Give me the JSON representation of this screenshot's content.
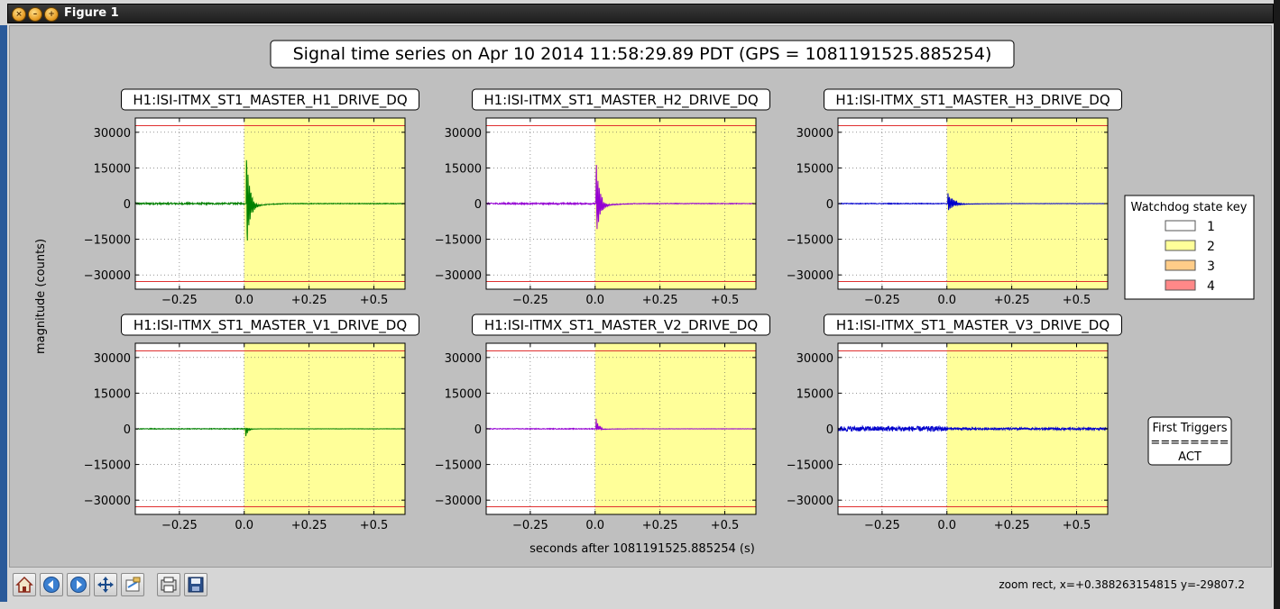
{
  "window": {
    "title": "Figure 1"
  },
  "figure": {
    "suptitle": "Signal time series on Apr 10 2014 11:58:29.89 PDT (GPS = 1081191525.885254)",
    "ylabel": "magnitude (counts)",
    "xlabel": "seconds after 1081191525.885254 (s)"
  },
  "legend": {
    "title": "Watchdog state key",
    "entries": [
      {
        "label": "1",
        "color": "#ffffff"
      },
      {
        "label": "2",
        "color": "#ffff99"
      },
      {
        "label": "3",
        "color": "#ffcc88"
      },
      {
        "label": "4",
        "color": "#ff8888"
      }
    ]
  },
  "triggers": {
    "line1": "First Triggers",
    "line2": "========",
    "line3": "ACT"
  },
  "toolbar": {
    "buttons": [
      "home-icon",
      "back-icon",
      "forward-icon",
      "pan-icon",
      "zoom-icon",
      "subplots-icon",
      "save-icon"
    ],
    "status": "zoom rect, x=+0.388263154815 y=-29807.2"
  },
  "chart_data": [
    {
      "type": "line",
      "title": "H1:ISI-ITMX_ST1_MASTER_H1_DRIVE_DQ",
      "color": "#008000",
      "xlim": [
        -0.42,
        0.62
      ],
      "ylim": [
        -36000,
        36000
      ],
      "xticks": [
        "−0.25",
        "0.0",
        "+0.25",
        "+0.5"
      ],
      "xtick_values": [
        -0.25,
        0,
        0.25,
        0.5
      ],
      "yticks": [
        "30000",
        "15000",
        "0",
        "−15000",
        "−30000"
      ],
      "ytick_values": [
        30000,
        15000,
        0,
        -15000,
        -30000
      ],
      "threshold": 32768,
      "state_regions": [
        {
          "x": [
            -0.42,
            0
          ],
          "state": "1"
        },
        {
          "x": [
            0,
            0.62
          ],
          "state": "2"
        }
      ],
      "transient": {
        "t0": 0.008,
        "peak_pos": 21000,
        "peak_neg": -22000,
        "decay": 0.012,
        "baseline_noise": 350
      }
    },
    {
      "type": "line",
      "title": "H1:ISI-ITMX_ST1_MASTER_H2_DRIVE_DQ",
      "color": "#9400d3",
      "xlim": [
        -0.42,
        0.62
      ],
      "ylim": [
        -36000,
        36000
      ],
      "xticks": [
        "−0.25",
        "0.0",
        "+0.25",
        "+0.5"
      ],
      "xtick_values": [
        -0.25,
        0,
        0.25,
        0.5
      ],
      "yticks": [
        "30000",
        "15000",
        "0",
        "−15000",
        "−30000"
      ],
      "ytick_values": [
        30000,
        15000,
        0,
        -15000,
        -30000
      ],
      "threshold": 32768,
      "state_regions": [
        {
          "x": [
            -0.42,
            0
          ],
          "state": "1"
        },
        {
          "x": [
            0,
            0.62
          ],
          "state": "2"
        }
      ],
      "transient": {
        "t0": 0.004,
        "peak_pos": 18000,
        "peak_neg": -17500,
        "decay": 0.012,
        "baseline_noise": 300
      }
    },
    {
      "type": "line",
      "title": "H1:ISI-ITMX_ST1_MASTER_H3_DRIVE_DQ",
      "color": "#0000cd",
      "xlim": [
        -0.42,
        0.62
      ],
      "ylim": [
        -36000,
        36000
      ],
      "xticks": [
        "−0.25",
        "0.0",
        "+0.25",
        "+0.5"
      ],
      "xtick_values": [
        -0.25,
        0,
        0.25,
        0.5
      ],
      "yticks": [
        "30000",
        "15000",
        "0",
        "−15000",
        "−30000"
      ],
      "ytick_values": [
        30000,
        15000,
        0,
        -15000,
        -30000
      ],
      "threshold": 32768,
      "state_regions": [
        {
          "x": [
            -0.42,
            0
          ],
          "state": "1"
        },
        {
          "x": [
            0,
            0.62
          ],
          "state": "2"
        }
      ],
      "transient": {
        "t0": 0.003,
        "peak_pos": 5000,
        "peak_neg": -3800,
        "decay": 0.02,
        "baseline_noise": 150
      }
    },
    {
      "type": "line",
      "title": "H1:ISI-ITMX_ST1_MASTER_V1_DRIVE_DQ",
      "color": "#008000",
      "xlim": [
        -0.42,
        0.62
      ],
      "ylim": [
        -36000,
        36000
      ],
      "xticks": [
        "−0.25",
        "0.0",
        "+0.25",
        "+0.5"
      ],
      "xtick_values": [
        -0.25,
        0,
        0.25,
        0.5
      ],
      "yticks": [
        "30000",
        "15000",
        "0",
        "−15000",
        "−30000"
      ],
      "ytick_values": [
        30000,
        15000,
        0,
        -15000,
        -30000
      ],
      "threshold": 32768,
      "state_regions": [
        {
          "x": [
            -0.42,
            0
          ],
          "state": "1"
        },
        {
          "x": [
            0,
            0.62
          ],
          "state": "2"
        }
      ],
      "transient": {
        "t0": 0.003,
        "peak_pos": 500,
        "peak_neg": -4500,
        "decay": 0.01,
        "baseline_noise": 150
      }
    },
    {
      "type": "line",
      "title": "H1:ISI-ITMX_ST1_MASTER_V2_DRIVE_DQ",
      "color": "#9400d3",
      "xlim": [
        -0.42,
        0.62
      ],
      "ylim": [
        -36000,
        36000
      ],
      "xticks": [
        "−0.25",
        "0.0",
        "+0.25",
        "+0.5"
      ],
      "xtick_values": [
        -0.25,
        0,
        0.25,
        0.5
      ],
      "yticks": [
        "30000",
        "15000",
        "0",
        "−15000",
        "−30000"
      ],
      "ytick_values": [
        30000,
        15000,
        0,
        -15000,
        -30000
      ],
      "threshold": 32768,
      "state_regions": [
        {
          "x": [
            -0.42,
            0
          ],
          "state": "1"
        },
        {
          "x": [
            0,
            0.62
          ],
          "state": "2"
        }
      ],
      "transient": {
        "t0": 0.003,
        "peak_pos": 4800,
        "peak_neg": -500,
        "decay": 0.01,
        "baseline_noise": 150
      }
    },
    {
      "type": "line",
      "title": "H1:ISI-ITMX_ST1_MASTER_V3_DRIVE_DQ",
      "color": "#0000cd",
      "xlim": [
        -0.42,
        0.62
      ],
      "ylim": [
        -36000,
        36000
      ],
      "xticks": [
        "−0.25",
        "0.0",
        "+0.25",
        "+0.5"
      ],
      "xtick_values": [
        -0.25,
        0,
        0.25,
        0.5
      ],
      "yticks": [
        "30000",
        "15000",
        "0",
        "−15000",
        "−30000"
      ],
      "ytick_values": [
        30000,
        15000,
        0,
        -15000,
        -30000
      ],
      "threshold": 32768,
      "state_regions": [
        {
          "x": [
            -0.42,
            0
          ],
          "state": "1"
        },
        {
          "x": [
            0,
            0.62
          ],
          "state": "2"
        }
      ],
      "transient": {
        "t0": 0.0,
        "peak_pos": 300,
        "peak_neg": -300,
        "decay": 0.01,
        "baseline_noise": 1100
      }
    }
  ]
}
